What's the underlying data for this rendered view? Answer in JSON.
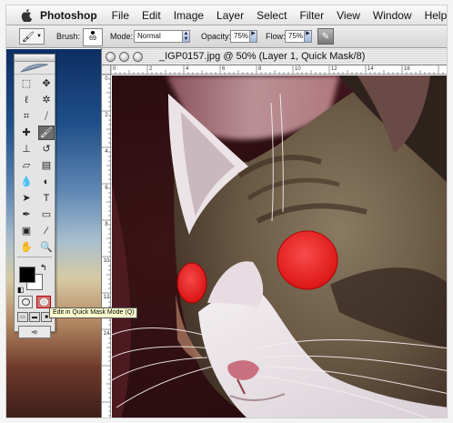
{
  "menubar": {
    "apple_icon": "apple-icon",
    "items": [
      "Photoshop",
      "File",
      "Edit",
      "Image",
      "Layer",
      "Select",
      "Filter",
      "View",
      "Window",
      "Help"
    ]
  },
  "options_bar": {
    "tool_preset_icon": "brush-icon",
    "brush_label": "Brush:",
    "brush_size": "69",
    "mode_label": "Mode:",
    "mode_value": "Normal",
    "opacity_label": "Opacity:",
    "opacity_value": "75%",
    "flow_label": "Flow:",
    "flow_value": "75%",
    "airbrush_icon": "airbrush-icon"
  },
  "toolbox": {
    "tools": [
      {
        "name": "marquee-tool",
        "glyph": "⬚",
        "selected": false
      },
      {
        "name": "move-tool",
        "glyph": "✥",
        "selected": false
      },
      {
        "name": "lasso-tool",
        "glyph": "ℓ",
        "selected": false
      },
      {
        "name": "magic-wand-tool",
        "glyph": "✲",
        "selected": false
      },
      {
        "name": "crop-tool",
        "glyph": "⌗",
        "selected": false
      },
      {
        "name": "slice-tool",
        "glyph": "⧸",
        "selected": false
      },
      {
        "name": "healing-brush-tool",
        "glyph": "✚",
        "selected": false
      },
      {
        "name": "brush-tool",
        "glyph": "🖌",
        "selected": true
      },
      {
        "name": "clone-stamp-tool",
        "glyph": "⊥",
        "selected": false
      },
      {
        "name": "history-brush-tool",
        "glyph": "↺",
        "selected": false
      },
      {
        "name": "eraser-tool",
        "glyph": "▱",
        "selected": false
      },
      {
        "name": "gradient-tool",
        "glyph": "▤",
        "selected": false
      },
      {
        "name": "blur-tool",
        "glyph": "💧",
        "selected": false
      },
      {
        "name": "dodge-tool",
        "glyph": "◐",
        "selected": false
      },
      {
        "name": "path-selection-tool",
        "glyph": "➤",
        "selected": false
      },
      {
        "name": "type-tool",
        "glyph": "T",
        "selected": false
      },
      {
        "name": "pen-tool",
        "glyph": "✒",
        "selected": false
      },
      {
        "name": "shape-tool",
        "glyph": "▭",
        "selected": false
      },
      {
        "name": "notes-tool",
        "glyph": "▣",
        "selected": false
      },
      {
        "name": "eyedropper-tool",
        "glyph": "⁄",
        "selected": false
      },
      {
        "name": "hand-tool",
        "glyph": "✋",
        "selected": false
      },
      {
        "name": "zoom-tool",
        "glyph": "🔍",
        "selected": false
      }
    ],
    "foreground_color": "#000000",
    "background_color": "#ffffff"
  },
  "tooltip": {
    "text": "Edit in Quick Mask Mode (Q)"
  },
  "document": {
    "title": "_IGP0157.jpg @ 50% (Layer 1, Quick Mask/8)",
    "ruler_h": [
      "0",
      "2",
      "4",
      "6",
      "8",
      "10",
      "12",
      "14",
      "16"
    ],
    "ruler_v": [
      "0",
      "2",
      "4",
      "6",
      "8",
      "10",
      "12",
      "14"
    ],
    "mask_color": "#ff1e1e"
  }
}
